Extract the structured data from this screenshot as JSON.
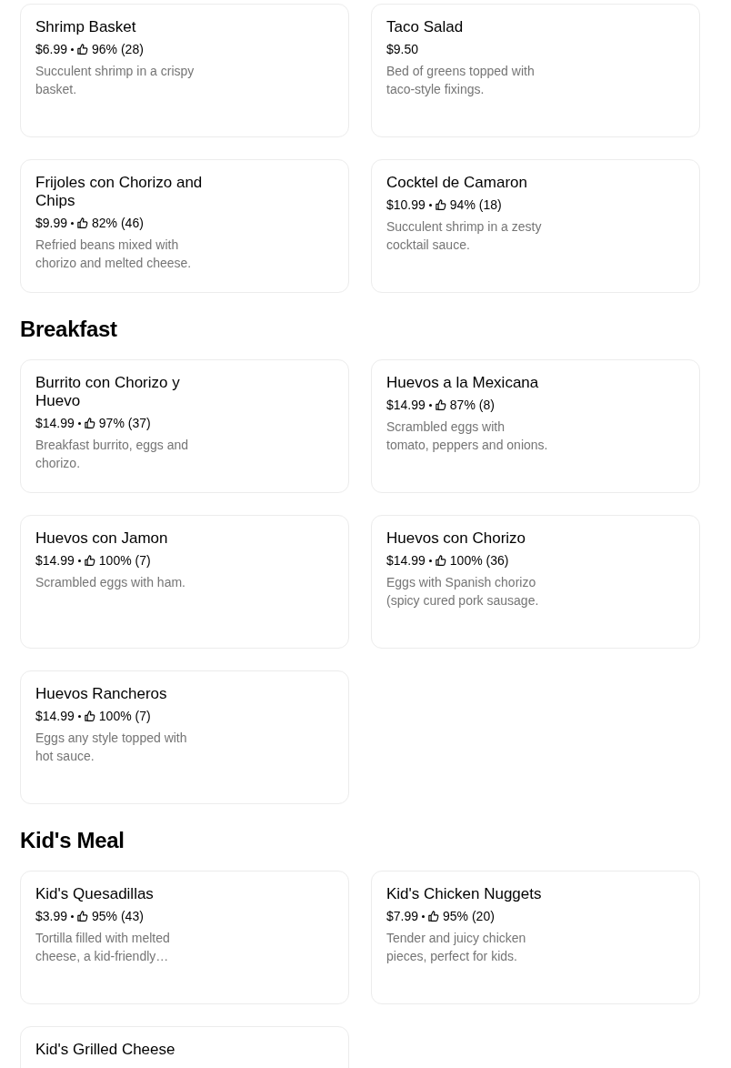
{
  "sections": [
    {
      "items": [
        {
          "name": "Shrimp Basket",
          "price": "$6.99",
          "rating": "96% (28)",
          "description": "Succulent shrimp in a crispy basket."
        },
        {
          "name": "Taco Salad",
          "price": "$9.50",
          "description": "Bed of greens topped with taco-style fixings."
        },
        {
          "name": "Frijoles con Chorizo and Chips",
          "price": "$9.99",
          "rating": "82% (46)",
          "description": "Refried beans mixed with chorizo and melted cheese."
        },
        {
          "name": "Cocktel de Camaron",
          "price": "$10.99",
          "rating": "94% (18)",
          "description": "Succulent shrimp in a zesty cocktail sauce."
        }
      ]
    },
    {
      "title": "Breakfast",
      "items": [
        {
          "name": "Burrito con Chorizo y Huevo",
          "price": "$14.99",
          "rating": "97% (37)",
          "description": "Breakfast burrito, eggs and chorizo."
        },
        {
          "name": "Huevos a la Mexicana",
          "price": "$14.99",
          "rating": "87% (8)",
          "description": "Scrambled eggs with tomato, peppers and onions."
        },
        {
          "name": "Huevos con Jamon",
          "price": "$14.99",
          "rating": "100% (7)",
          "description": "Scrambled eggs with ham."
        },
        {
          "name": "Huevos con Chorizo",
          "price": "$14.99",
          "rating": "100% (36)",
          "description": "Eggs with Spanish chorizo (spicy cured pork sausage."
        },
        {
          "name": "Huevos Rancheros",
          "price": "$14.99",
          "rating": "100% (7)",
          "description": "Eggs any style topped with hot sauce."
        }
      ]
    },
    {
      "title": "Kid's Meal",
      "items": [
        {
          "name": "Kid's Quesadillas",
          "price": "$3.99",
          "rating": "95% (43)",
          "description": "Tortilla filled with melted cheese, a kid-friendly…"
        },
        {
          "name": "Kid's Chicken Nuggets",
          "price": "$7.99",
          "rating": "95% (20)",
          "description": "Tender and juicy chicken pieces, perfect for kids."
        },
        {
          "name": "Kid's Grilled Cheese"
        }
      ]
    }
  ]
}
